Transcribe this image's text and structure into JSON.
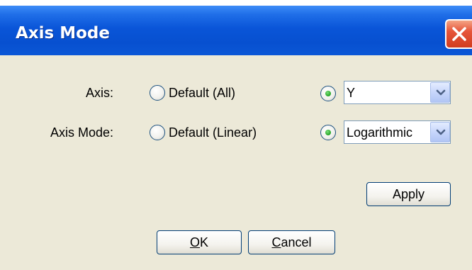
{
  "window": {
    "title": "Axis Mode"
  },
  "axis": {
    "label": "Axis:",
    "default_option": "Default (All)",
    "custom_selected": true,
    "select_value": "Y"
  },
  "axis_mode": {
    "label": "Axis Mode:",
    "default_option": "Default (Linear)",
    "custom_selected": true,
    "select_value": "Logarithmic"
  },
  "buttons": {
    "apply": "Apply",
    "ok_mnemonic": "O",
    "ok_rest": "K",
    "cancel_mnemonic": "C",
    "cancel_rest": "ancel"
  },
  "colors": {
    "title_bar": "#0a55d8",
    "close_button": "#d13c1f",
    "dialog_background": "#ece9d8",
    "radio_selected": "#2faa2f"
  },
  "icons": {
    "close": "close-x-icon",
    "dropdown": "chevron-down-icon"
  }
}
